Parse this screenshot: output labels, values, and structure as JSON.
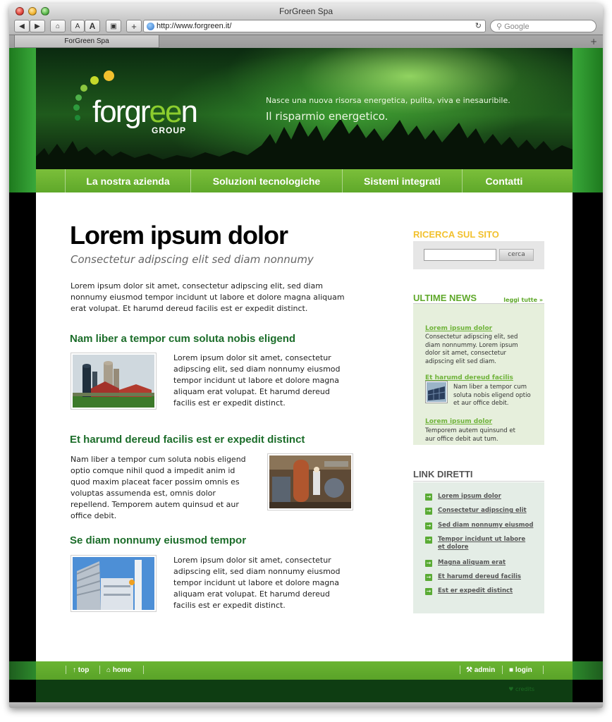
{
  "browser": {
    "window_title": "ForGreen Spa",
    "address": "http://www.forgreen.it/",
    "search_placeholder": "Google",
    "tab_title": "ForGreen Spa",
    "btn_back": "◀",
    "btn_forward": "▶",
    "btn_home": "⌂",
    "btn_text_small": "A",
    "btn_text_large": "A",
    "btn_snapshot": "▣",
    "btn_add": "+",
    "reload": "↻",
    "tab_add": "+"
  },
  "header": {
    "logo_text_a": "forgr",
    "logo_text_b": "ee",
    "logo_text_c": "n",
    "logo_sub": "GROUP",
    "tagline_small": "Nasce una nuova risorsa energetica, pulita, viva e inesauribile.",
    "tagline_large": "Il risparmio energetico."
  },
  "nav": {
    "items": [
      {
        "label": "La nostra azienda"
      },
      {
        "label": "Soluzioni tecnologiche"
      },
      {
        "label": "Sistemi integrati"
      },
      {
        "label": "Contatti"
      }
    ]
  },
  "main": {
    "title": "Lorem ipsum dolor",
    "subtitle": "Consectetur adipscing elit sed diam nonnumy",
    "intro": "Lorem ipsum dolor sit amet, consectetur adipscing elit, sed diam nonnumy eiusmod tempor incidunt ut labore et dolore magna aliquam erat volupat. Et harumd dereud facilis est er expedit distinct.",
    "sections": [
      {
        "title": "Nam liber a tempor cum soluta nobis eligend",
        "text": "Lorem ipsum dolor sit amet, consectetur adipscing elit, sed diam nonnumy eiusmod tempor incidunt ut labore et dolore magna aliquam erat volupat. Et harumd dereud facilis est er expedit distinct."
      },
      {
        "title": "Et harumd dereud facilis est er expedit distinct",
        "text": "Nam liber a tempor cum soluta nobis eligend optio comque nihil quod a impedit anim id quod maxim placeat facer possim omnis es voluptas assumenda est, omnis dolor repellend. Temporem autem quinsud et aur office debit."
      },
      {
        "title": "Se diam nonnumy eiusmod tempor",
        "text": "Lorem ipsum dolor sit amet, consectetur adipscing elit, sed diam nonnumy eiusmod tempor incidunt ut labore et dolore magna aliquam erat volupat. Et harumd dereud facilis est er expedit distinct."
      }
    ]
  },
  "sidebar": {
    "search_title": "RICERCA SUL SITO",
    "search_button": "cerca",
    "news_title": "ULTIME NEWS",
    "news_more": "leggi tutte »",
    "news": [
      {
        "title": "Lorem ipsum dolor",
        "text": "Consectetur adipscing elit, sed diam nonnummy. Lorem ipsum dolor sit amet, consectetur adipscing elit sed diam."
      },
      {
        "title": "Et harumd dereud facilis",
        "text": "Nam liber a tempor cum soluta nobis eligend optio et aur office debit."
      },
      {
        "title": "Lorem ipsum dolor",
        "text": "Temporem autem quinsund et aur office debit aut tum."
      }
    ],
    "links_title": "LINK DIRETTI",
    "links": [
      {
        "label": "Lorem ipsum dolor"
      },
      {
        "label": "Consectetur adipscing elit"
      },
      {
        "label": "Sed diam nonnumy eiusmod"
      },
      {
        "label": "Tempor incidunt ut labore et dolore"
      },
      {
        "label": "Magna aliquam erat"
      },
      {
        "label": "Et harumd dereud facilis"
      },
      {
        "label": "Est er expedit distinct"
      }
    ]
  },
  "footer": {
    "top": "top",
    "home": "home",
    "admin": "admin",
    "login": "login",
    "credits": "credits"
  },
  "colors": {
    "brand_green": "#5fa82a",
    "heading_green": "#1c6d2a",
    "accent_yellow": "#f2c12e",
    "news_link": "#6fb33a"
  }
}
